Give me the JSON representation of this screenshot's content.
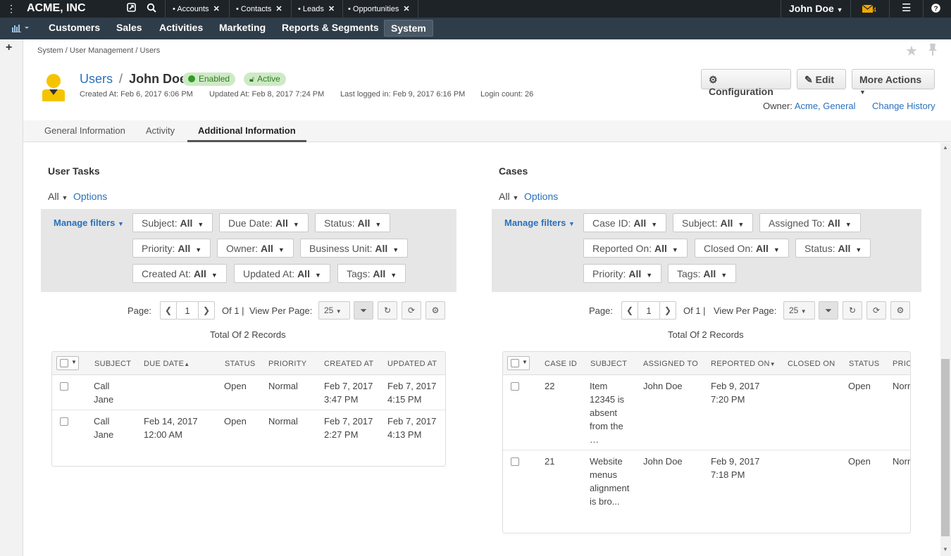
{
  "topbar": {
    "company": "ACME, INC",
    "pins": [
      "Accounts",
      "Contacts",
      "Leads",
      "Opportunities"
    ],
    "user": "John Doe",
    "notif_count": "4"
  },
  "nav": {
    "items": [
      "Customers",
      "Sales",
      "Activities",
      "Marketing",
      "Reports & Segments",
      "System"
    ],
    "active": "System"
  },
  "breadcrumb": "System / User Management / Users",
  "header": {
    "section": "Users",
    "sep": "/",
    "name": "John Doe",
    "badge_enabled": "Enabled",
    "badge_active": "Active",
    "created": "Created At: Feb 6, 2017 6:06 PM",
    "updated": "Updated At: Feb 8, 2017 7:24 PM",
    "lastlogin": "Last logged in: Feb 9, 2017 6:16 PM",
    "logincount": "Login count: 26",
    "btn_config": "Configuration",
    "btn_edit": "Edit",
    "btn_more": "More Actions",
    "owner_label": "Owner:",
    "owner_value": "Acme, General",
    "change_history": "Change History"
  },
  "tabs": [
    "General Information",
    "Activity",
    "Additional Information"
  ],
  "tasks": {
    "title": "User Tasks",
    "all": "All",
    "options": "Options",
    "manage": "Manage filters",
    "filters": [
      {
        "label": "Subject:",
        "value": "All"
      },
      {
        "label": "Due Date:",
        "value": "All"
      },
      {
        "label": "Status:",
        "value": "All"
      },
      {
        "label": "Priority:",
        "value": "All"
      },
      {
        "label": "Owner:",
        "value": "All"
      },
      {
        "label": "Business Unit:",
        "value": "All"
      },
      {
        "label": "Created At:",
        "value": "All"
      },
      {
        "label": "Updated At:",
        "value": "All"
      },
      {
        "label": "Tags:",
        "value": "All"
      }
    ],
    "page_label": "Page:",
    "page": "1",
    "of": "Of 1 |",
    "per_page_label": "View Per Page:",
    "per_page": "25",
    "total": "Total Of 2 Records",
    "columns": [
      "SUBJECT",
      "DUE DATE",
      "STATUS",
      "PRIORITY",
      "CREATED AT",
      "UPDATED AT"
    ],
    "rows": [
      {
        "subject1": "Call",
        "subject2": "Jane",
        "due1": "",
        "due2": "",
        "status": "Open",
        "priority": "Normal",
        "c1": "Feb 7, 2017",
        "c2": "3:47 PM",
        "u1": "Feb 7, 2017",
        "u2": "4:15 PM"
      },
      {
        "subject1": "Call",
        "subject2": "Jane",
        "due1": "Feb 14, 2017",
        "due2": "12:00 AM",
        "status": "Open",
        "priority": "Normal",
        "c1": "Feb 7, 2017",
        "c2": "2:27 PM",
        "u1": "Feb 7, 2017",
        "u2": "4:13 PM"
      }
    ]
  },
  "cases": {
    "title": "Cases",
    "all": "All",
    "options": "Options",
    "manage": "Manage filters",
    "filters": [
      {
        "label": "Case ID:",
        "value": "All"
      },
      {
        "label": "Subject:",
        "value": "All"
      },
      {
        "label": "Assigned To:",
        "value": "All"
      },
      {
        "label": "Reported On:",
        "value": "All"
      },
      {
        "label": "Closed On:",
        "value": "All"
      },
      {
        "label": "Status:",
        "value": "All"
      },
      {
        "label": "Priority:",
        "value": "All"
      },
      {
        "label": "Tags:",
        "value": "All"
      }
    ],
    "page_label": "Page:",
    "page": "1",
    "of": "Of 1 |",
    "per_page_label": "View Per Page:",
    "per_page": "25",
    "total": "Total Of 2 Records",
    "columns": [
      "CASE ID",
      "SUBJECT",
      "ASSIGNED TO",
      "REPORTED ON",
      "CLOSED ON",
      "STATUS",
      "PRIO"
    ],
    "rows": [
      {
        "id": "22",
        "s1": "Item",
        "s2": "12345 is",
        "s3": "absent",
        "s4": "from the",
        "s5": "…",
        "assigned": "John Doe",
        "r1": "Feb 9, 2017",
        "r2": "7:20 PM",
        "status": "Open",
        "priority": "Norm"
      },
      {
        "id": "21",
        "s1": "Website",
        "s2": "menus",
        "s3": "alignment",
        "s4": "is bro...",
        "s5": "",
        "assigned": "John Doe",
        "r1": "Feb 9, 2017",
        "r2": "7:18 PM",
        "status": "Open",
        "priority": "Norm"
      }
    ]
  }
}
